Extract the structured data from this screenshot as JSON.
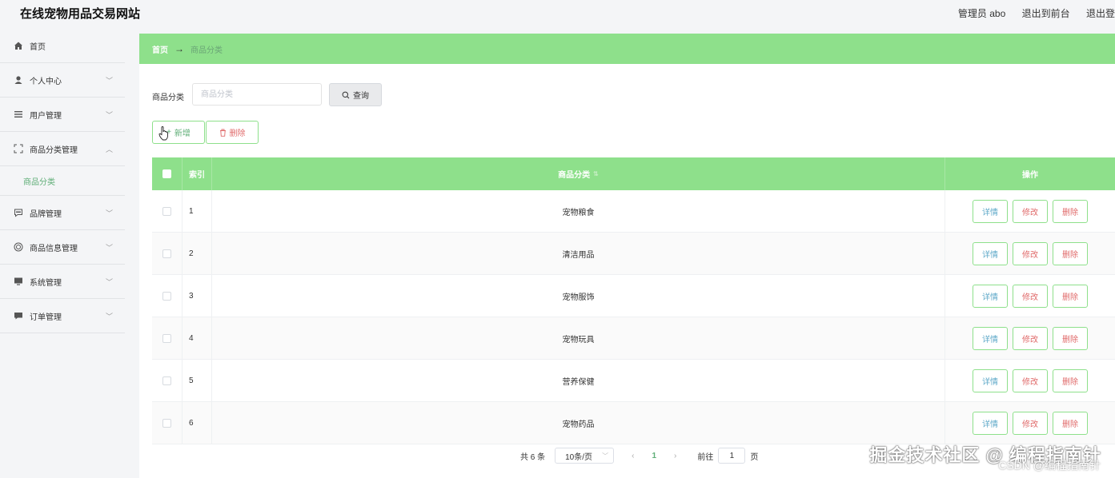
{
  "header": {
    "site_title": "在线宠物用品交易网站",
    "admin_label": "管理员 abo",
    "exit_front": "退出到前台",
    "logout": "退出登"
  },
  "sidebar": {
    "items": [
      {
        "label": "首页",
        "icon": "home-icon"
      },
      {
        "label": "个人中心",
        "icon": "user-icon"
      },
      {
        "label": "用户管理",
        "icon": "list-icon"
      },
      {
        "label": "商品分类管理",
        "icon": "expand-icon"
      },
      {
        "label": "品牌管理",
        "icon": "chat-icon"
      },
      {
        "label": "商品信息管理",
        "icon": "globe-icon"
      },
      {
        "label": "系统管理",
        "icon": "monitor-icon"
      },
      {
        "label": "订单管理",
        "icon": "message-icon"
      }
    ],
    "active_sub": "商品分类"
  },
  "breadcrumb": {
    "home": "首页",
    "arrow": "→",
    "current": "商品分类"
  },
  "search": {
    "label": "商品分类",
    "placeholder": "商品分类",
    "button": "查询"
  },
  "actions": {
    "add": "新增",
    "delete": "删除"
  },
  "table": {
    "headers": {
      "index": "索引",
      "name": "商品分类",
      "ops": "操作"
    },
    "rows": [
      {
        "index": "1",
        "name": "宠物粮食"
      },
      {
        "index": "2",
        "name": "清洁用品"
      },
      {
        "index": "3",
        "name": "宠物服饰"
      },
      {
        "index": "4",
        "name": "宠物玩具"
      },
      {
        "index": "5",
        "name": "营养保健"
      },
      {
        "index": "6",
        "name": "宠物药品"
      }
    ],
    "row_actions": {
      "detail": "详情",
      "edit": "修改",
      "delete": "删除"
    }
  },
  "pagination": {
    "total": "共 6 条",
    "page_size": "10条/页",
    "prev": "‹",
    "current_page": "1",
    "next": "›",
    "goto": "前往",
    "goto_value": "1",
    "page_unit": "页"
  },
  "watermark": {
    "line1": "掘金技术社区 @ 编程指南针",
    "line2": "CSDN @编程指南针"
  },
  "colors": {
    "accent": "#8ee08b",
    "accent_text": "#5fae77",
    "danger": "#e06a6a",
    "info": "#5fa9c9"
  }
}
